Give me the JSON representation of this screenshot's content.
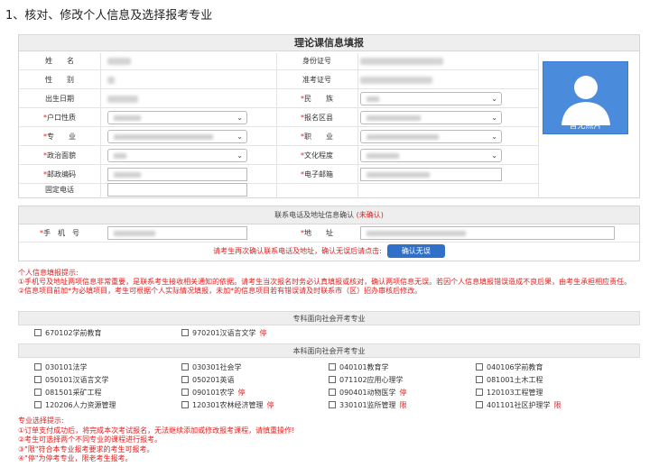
{
  "heading": "1、核对、修改个人信息及选择报考专业",
  "form": {
    "title": "理论课信息填报",
    "labels": {
      "name": "姓　　名",
      "gender": "性　　别",
      "birth": "出生日期",
      "hukou": "户口性质",
      "major": "专　　业",
      "politics": "政治面貌",
      "postcode": "邮政编码",
      "phone": "固定电话",
      "id_number": "身份证号",
      "exam_number": "准考证号",
      "ethnicity": "民　　族",
      "exam_district": "报名区县",
      "occupation": "职　　业",
      "education": "文化程度",
      "email": "电子邮箱"
    },
    "required_mark": "*",
    "photo_caption": "暂无照片"
  },
  "contact": {
    "title_prefix": "联系电话及地址信息确认",
    "title_status": "(未确认)",
    "mobile_label": "手　机　号",
    "address_label": "地　　址",
    "confirm_text": "请考生再次确认联系电话及地址，确认无误后请点击:",
    "confirm_button": "确认无误"
  },
  "tips1": {
    "title": "个人信息填报提示:",
    "lines": [
      "①手机号及地址两项信息非常重要，是联系考生接收相关通知的依据。请考生当次报名时务必认真填报或核对，确认两项信息无误。若因个人信息填报错误造成不良后果，由考生承担相应责任。",
      "②信息项目前加*为必填项目，考生可根据个人实际情况填报，未加*的信息项目若有错误请及时联系市（区）招办审核后修改。"
    ]
  },
  "specialty": {
    "title": "专科面向社会开考专业",
    "items": [
      {
        "label": "670102学前教育",
        "tag": ""
      },
      {
        "label": "970201汉语言文学",
        "tag": "停"
      }
    ]
  },
  "undergrad": {
    "title": "本科面向社会开考专业",
    "items": [
      {
        "label": "030101法学",
        "tag": ""
      },
      {
        "label": "030301社会学",
        "tag": ""
      },
      {
        "label": "040101教育学",
        "tag": ""
      },
      {
        "label": "040106学前教育",
        "tag": ""
      },
      {
        "label": "050101汉语言文学",
        "tag": ""
      },
      {
        "label": "050201英语",
        "tag": ""
      },
      {
        "label": "071102应用心理学",
        "tag": ""
      },
      {
        "label": "081001土木工程",
        "tag": ""
      },
      {
        "label": "081501采矿工程",
        "tag": ""
      },
      {
        "label": "090101农学",
        "tag": "停"
      },
      {
        "label": "090401动物医学",
        "tag": "停"
      },
      {
        "label": "120103工程管理",
        "tag": ""
      },
      {
        "label": "120206人力资源管理",
        "tag": ""
      },
      {
        "label": "120301农林经济管理",
        "tag": "停"
      },
      {
        "label": "330101监所管理",
        "tag": "限"
      },
      {
        "label": "401101社区护理学",
        "tag": "限"
      }
    ]
  },
  "tips2": {
    "title": "专业选择提示:",
    "lines": [
      "①订单支付成功后，将完成本次考试报名，无法继续添加或修改报考课程，请慎重操作!",
      "②考生可选择两个不同专业的课程进行报考。",
      "③\"限\"符合本专业报考要求的考生可报考。",
      "④\"停\"为停考专业，限老考生报考。"
    ]
  },
  "colors": {
    "required": "#e02020",
    "photo_bg": "#4a8bdc",
    "button_bg": "#3070c8"
  }
}
